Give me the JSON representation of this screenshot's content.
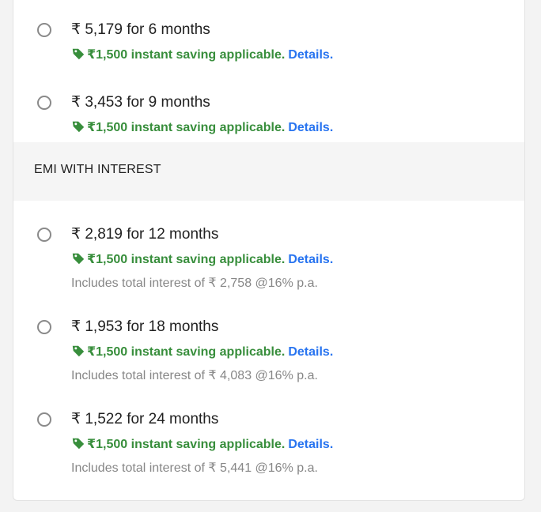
{
  "no_cost_options": [
    {
      "title": "₹ 5,179 for 6 months",
      "saving": "₹1,500 instant saving applicable.",
      "details": "Details."
    },
    {
      "title": "₹ 3,453 for 9 months",
      "saving": "₹1,500 instant saving applicable.",
      "details": "Details."
    }
  ],
  "interest_section": {
    "heading": "EMI WITH INTEREST"
  },
  "interest_options": [
    {
      "title": "₹ 2,819 for 12 months",
      "saving": "₹1,500 instant saving applicable.",
      "details": "Details.",
      "interest": "Includes total interest of ₹ 2,758 @16% p.a."
    },
    {
      "title": "₹ 1,953 for 18 months",
      "saving": "₹1,500 instant saving applicable.",
      "details": "Details.",
      "interest": "Includes total interest of ₹ 4,083 @16% p.a."
    },
    {
      "title": "₹ 1,522 for 24 months",
      "saving": "₹1,500 instant saving applicable.",
      "details": "Details.",
      "interest": "Includes total interest of ₹ 5,441 @16% p.a."
    }
  ],
  "icons": {
    "radio": "radio-button-icon",
    "tag": "price-tag-icon"
  },
  "colors": {
    "saving_green": "#388e3c",
    "link_blue": "#2874f0",
    "muted_text": "#878787",
    "section_bg": "#f5f5f5"
  }
}
